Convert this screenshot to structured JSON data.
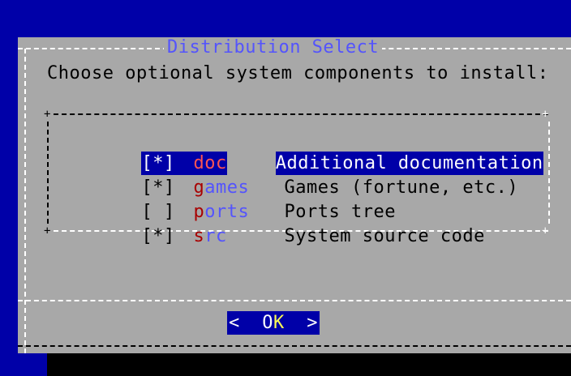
{
  "dialog": {
    "title": "Distribution Select",
    "prompt": "Choose optional system components to install:"
  },
  "items": [
    {
      "check": "[*]",
      "name": "doc",
      "description": "Additional documentation",
      "selected": true
    },
    {
      "check": "[*]",
      "name": "games",
      "description": "Games (fortune, etc.)",
      "selected": false
    },
    {
      "check": "[ ]",
      "name": "ports",
      "description": "Ports tree",
      "selected": false
    },
    {
      "check": "[*]",
      "name": "src",
      "description": "System source code",
      "selected": false
    }
  ],
  "buttons": {
    "ok_left": "<",
    "ok_pre": "  O",
    "ok_hotkey": "K",
    "ok_post": "  >"
  },
  "colors": {
    "desktop": "#0000a8",
    "dialog": "#a8a8a8",
    "title": "#5454fc",
    "hotkey": "#fcfc54",
    "item_name": "#a80000"
  }
}
